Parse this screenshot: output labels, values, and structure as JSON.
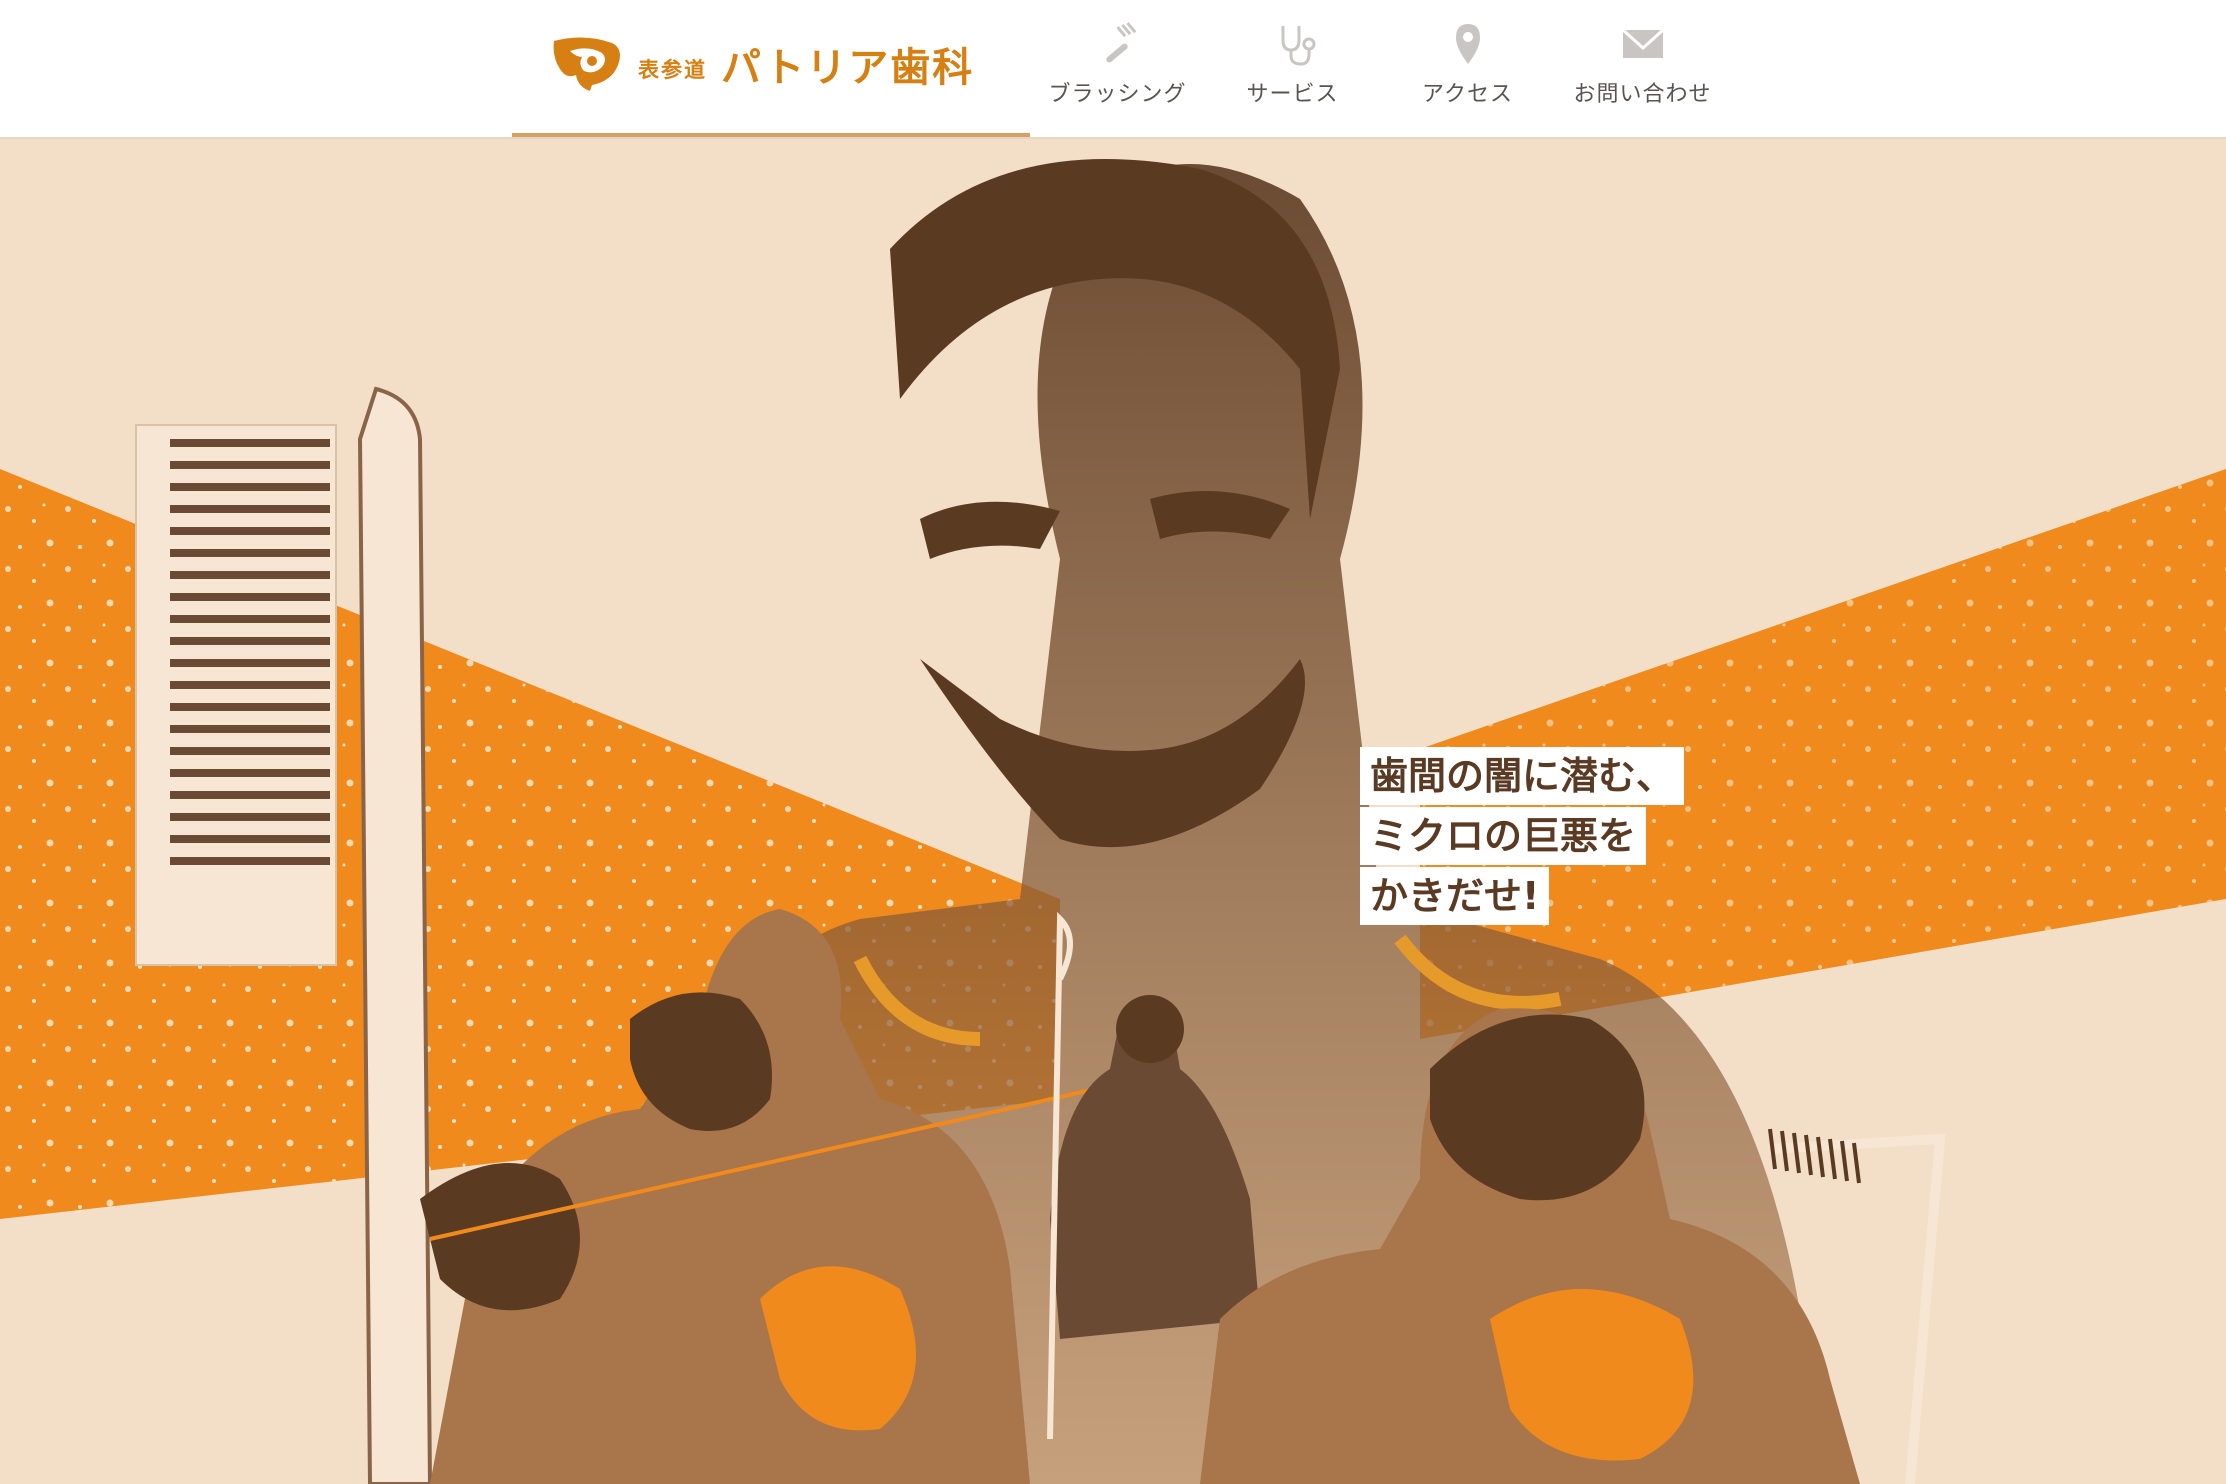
{
  "brand": {
    "small_text": "表参道",
    "name": "パトリア歯科",
    "logo_icon": "patria-dental-logo-icon",
    "accent_color": "#d67f12"
  },
  "nav": {
    "items": [
      {
        "label": "ブラッシング",
        "icon": "toothbrush-icon"
      },
      {
        "label": "サービス",
        "icon": "stethoscope-icon"
      },
      {
        "label": "アクセス",
        "icon": "map-pin-icon"
      },
      {
        "label": "お問い合わせ",
        "icon": "envelope-icon"
      }
    ]
  },
  "hero": {
    "tagline": [
      "歯間の闇に潜む、",
      "ミクロの巨悪を",
      "かきだせ!"
    ],
    "colors": {
      "background": "#f3dfc7",
      "orange": "#f08a1c",
      "brown": "#5b3a22",
      "tan": "#a8764a"
    }
  }
}
